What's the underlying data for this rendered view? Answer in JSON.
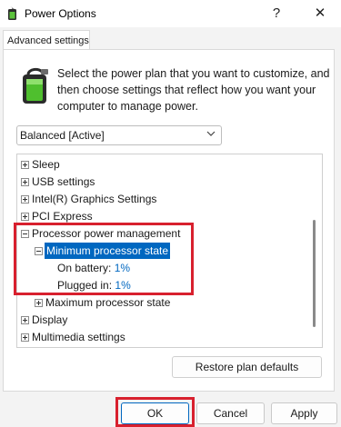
{
  "window": {
    "title": "Power Options",
    "help_glyph": "?",
    "close_glyph": "✕"
  },
  "tab": {
    "label": "Advanced settings"
  },
  "description": "Select the power plan that you want to customize, and then choose settings that reflect how you want your computer to manage power.",
  "plan_select": {
    "value": "Balanced [Active]"
  },
  "tree": {
    "items": [
      {
        "label": "Sleep",
        "expander": "plus"
      },
      {
        "label": "USB settings",
        "expander": "plus"
      },
      {
        "label": "Intel(R) Graphics Settings",
        "expander": "plus"
      },
      {
        "label": "PCI Express",
        "expander": "plus"
      },
      {
        "label": "Processor power management",
        "expander": "minus"
      },
      {
        "label": "Minimum processor state",
        "expander": "minus",
        "selected": true
      },
      {
        "label": "On battery:",
        "value": "1%"
      },
      {
        "label": "Plugged in:",
        "value": "1%"
      },
      {
        "label": "Maximum processor state",
        "expander": "plus"
      },
      {
        "label": "Display",
        "expander": "plus"
      },
      {
        "label": "Multimedia settings",
        "expander": "plus"
      }
    ]
  },
  "buttons": {
    "restore": "Restore plan defaults",
    "ok": "OK",
    "cancel": "Cancel",
    "apply": "Apply"
  },
  "colors": {
    "accent": "#0067c0",
    "highlight": "#d8202e"
  }
}
